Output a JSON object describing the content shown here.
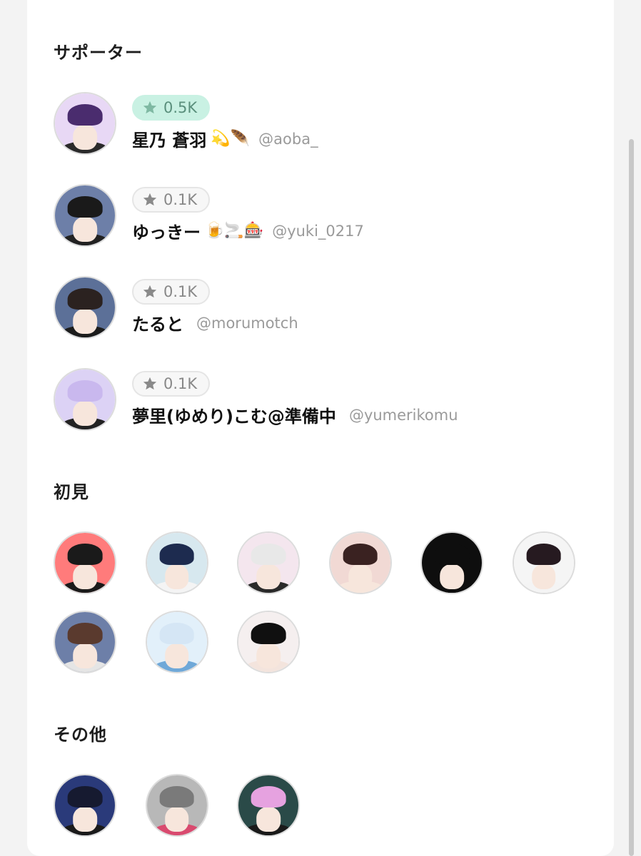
{
  "sections": {
    "supporters_title": "サポーター",
    "first_time_title": "初見",
    "others_title": "その他"
  },
  "supporters": [
    {
      "badge": "0.5K",
      "name": "星乃 蒼羽",
      "emoji": "💫🪶",
      "handle": "@aoba_",
      "highlight": true,
      "colors": {
        "bg": "#e8d8f5",
        "hair": "#4a2c6e",
        "body": "#2a2a2a"
      }
    },
    {
      "badge": "0.1K",
      "name": "ゆっきー",
      "emoji": "🍺🚬🎰",
      "handle": "@yuki_0217",
      "highlight": false,
      "colors": {
        "bg": "#6d7fa8",
        "hair": "#1a1a1a",
        "body": "#222222"
      }
    },
    {
      "badge": "0.1K",
      "name": "たると",
      "emoji": "",
      "handle": "@morumotch",
      "highlight": false,
      "colors": {
        "bg": "#5c7098",
        "hair": "#2b2220",
        "body": "#1c1c1c"
      }
    },
    {
      "badge": "0.1K",
      "name": "夢里(ゆめり)こむ@準備中",
      "emoji": "",
      "handle": "@yumerikomu",
      "highlight": false,
      "colors": {
        "bg": "#dcd2f5",
        "hair": "#c9b8ee",
        "body": "#222222"
      }
    }
  ],
  "first_time": [
    {
      "bg": "#ff7b7b",
      "hair": "#1a1a1a",
      "body": "#1a1a1a"
    },
    {
      "bg": "#d7e8ef",
      "hair": "#1d2b4f",
      "body": "#f4f4f4"
    },
    {
      "bg": "#f4e6ee",
      "hair": "#e8e8e8",
      "body": "#2a2a2a"
    },
    {
      "bg": "#f1d9d4",
      "hair": "#3a2221",
      "body": "#f7e6dc"
    },
    {
      "bg": "#0e0e0e",
      "hair": "#0e0e0e",
      "body": "#0e0e0e"
    },
    {
      "bg": "#f5f5f5",
      "hair": "#261a20",
      "body": "#f4f4f4"
    },
    {
      "bg": "#6d7fa8",
      "hair": "#5a3a2e",
      "body": "#e5e5e5"
    },
    {
      "bg": "#e2f0fa",
      "hair": "#d5e6f5",
      "body": "#6fa8d8"
    },
    {
      "bg": "#f5efef",
      "hair": "#101010",
      "body": "#f3e4dd"
    }
  ],
  "others": [
    {
      "bg": "#2a3a7a",
      "hair": "#161a30",
      "body": "#1a1a1a"
    },
    {
      "bg": "#b8b8b8",
      "hair": "#7a7a7a",
      "body": "#d94a6f"
    },
    {
      "bg": "#2a4a48",
      "hair": "#e6a2e0",
      "body": "#1a1a1a"
    }
  ]
}
